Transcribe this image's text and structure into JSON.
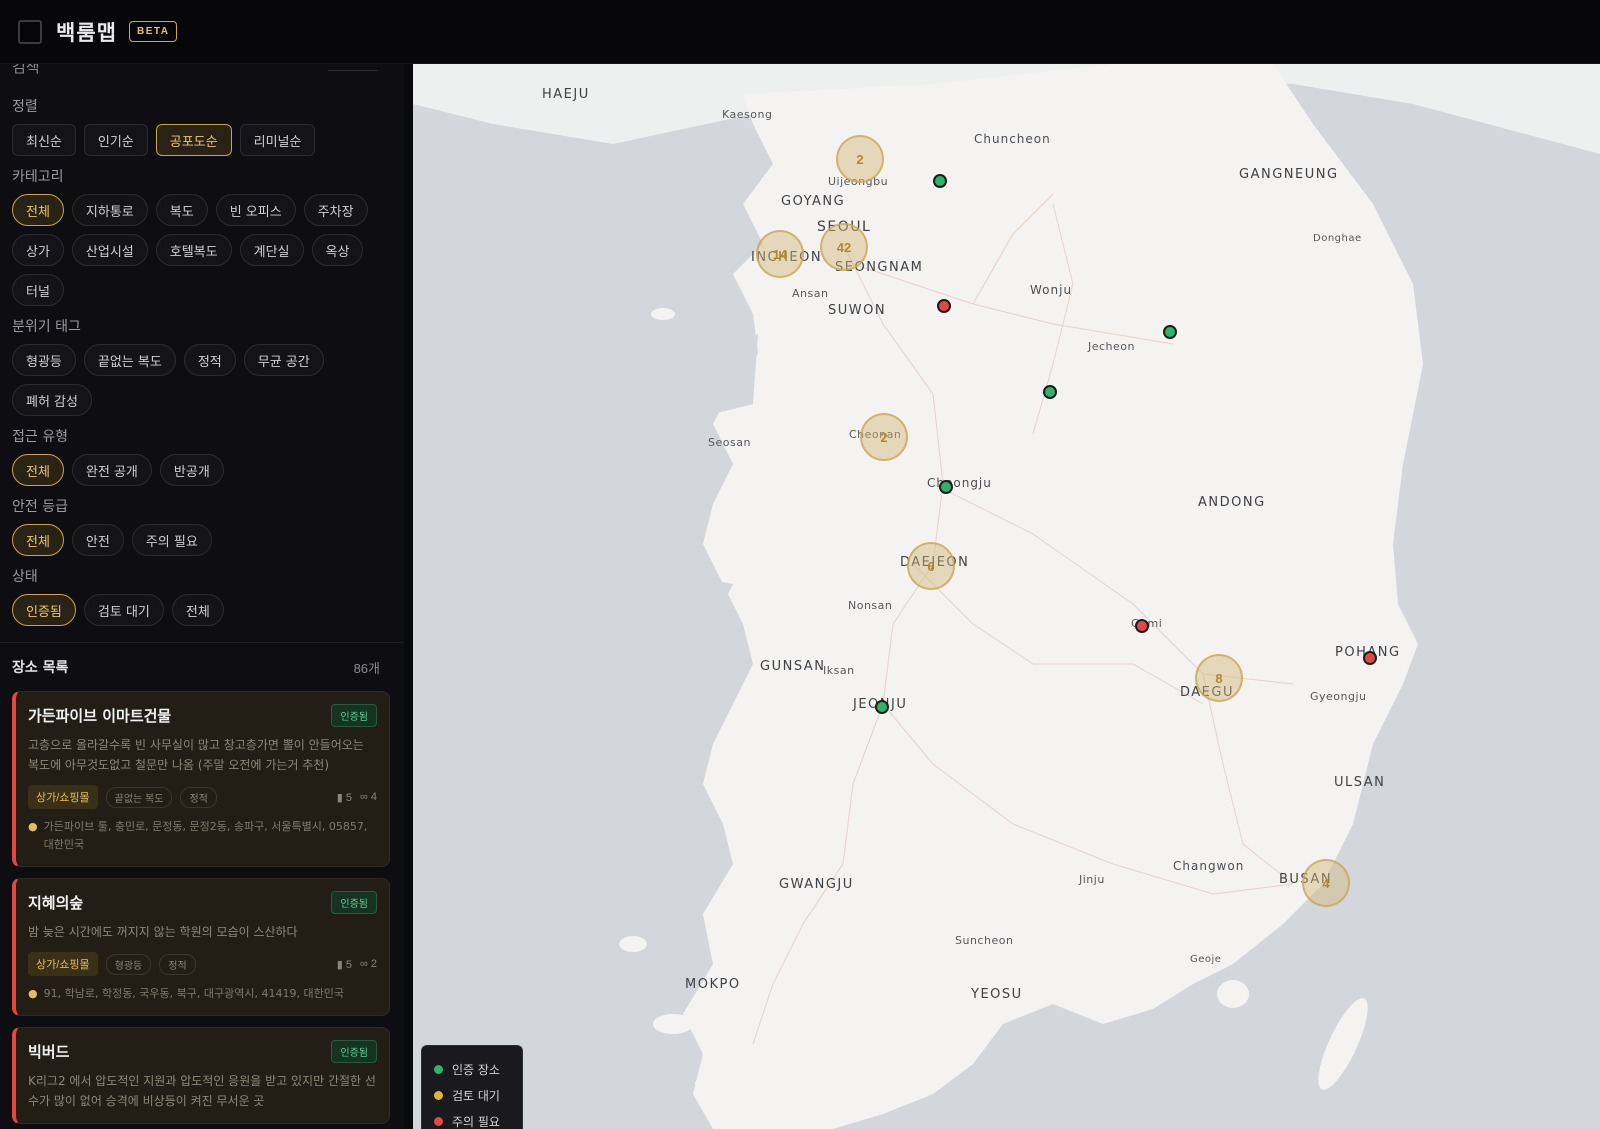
{
  "header": {
    "title": "백룸맵",
    "badge": "BETA"
  },
  "sidebar": {
    "cut_text": "검색",
    "sort": {
      "label": "정렬",
      "options": [
        "최신순",
        "인기순",
        "공포도순",
        "리미널순"
      ],
      "active": 2
    },
    "category": {
      "label": "카테고리",
      "options": [
        "전체",
        "지하통로",
        "복도",
        "빈 오피스",
        "주차장",
        "상가",
        "산업시설",
        "호텔복도",
        "계단실",
        "옥상",
        "터널"
      ],
      "active": 0
    },
    "mood": {
      "label": "분위기 태그",
      "options": [
        "형광등",
        "끝없는 복도",
        "정적",
        "무균 공간",
        "폐허 감성"
      ]
    },
    "access": {
      "label": "접근 유형",
      "options": [
        "전체",
        "완전 공개",
        "반공개"
      ],
      "active": 0
    },
    "safety": {
      "label": "안전 등급",
      "options": [
        "전체",
        "안전",
        "주의 필요"
      ],
      "active": 0
    },
    "status": {
      "label": "상태",
      "options": [
        "인증됨",
        "검토 대기",
        "전체"
      ],
      "active": 0
    },
    "list": {
      "title": "장소 목록",
      "count": "86개",
      "items": [
        {
          "name": "가든파이브 이마트건물",
          "badge": "인증됨",
          "desc": "고층으로 올라갈수록 빈 사무실이 많고 창고층가면 뽈이 안들어오는 복도에 아무것도없고 철문만 나옴 (주말 오전에 가는거 추천)",
          "category": "상가/쇼핑몰",
          "tags": [
            "끝없는 복도",
            "정적"
          ],
          "stat1": "5",
          "stat2": "4",
          "address": "가든파이브 툴, 충민로, 문정동, 문정2동, 송파구, 서울특별시, 05857, 대한민국"
        },
        {
          "name": "지혜의숲",
          "badge": "인증됨",
          "desc": "밤 늦은 시간에도 꺼지지 않는 학원의 모습이 스산하다",
          "category": "상가/쇼핑몰",
          "tags": [
            "형광등",
            "정적"
          ],
          "stat1": "5",
          "stat2": "2",
          "address": "91, 학남로, 학정동, 국우동, 북구, 대구광역시, 41419, 대한민국"
        },
        {
          "name": "빅버드",
          "badge": "인증됨",
          "desc": "K리그2 에서 압도적인 지원과 압도적인 응원을 받고 있지만 간절한 선수가 많이 없어 승격에 비상등이 켜진 무서운 곳",
          "category": "",
          "tags": [],
          "stat1": "",
          "stat2": "",
          "address": ""
        }
      ]
    }
  },
  "map": {
    "labels": [
      {
        "text": "HAEJU",
        "cls": "big"
      },
      {
        "text": "Kaesong",
        "cls": "small"
      },
      {
        "text": "Chuncheon",
        "cls": ""
      },
      {
        "text": "GANGNEUNG",
        "cls": "big"
      },
      {
        "text": "Uijeongbu",
        "cls": "small"
      },
      {
        "text": "GOYANG",
        "cls": "big"
      },
      {
        "text": "SEOUL",
        "cls": "big"
      },
      {
        "text": "Donghae",
        "cls": "small"
      },
      {
        "text": "INCHEON",
        "cls": "big"
      },
      {
        "text": "SEONGNAM",
        "cls": "big"
      },
      {
        "text": "Ansan",
        "cls": "small"
      },
      {
        "text": "SUWON",
        "cls": "big"
      },
      {
        "text": "Wonju",
        "cls": ""
      },
      {
        "text": "Jecheon",
        "cls": "small"
      },
      {
        "text": "Seosan",
        "cls": "small"
      },
      {
        "text": "Cheonan",
        "cls": "small"
      },
      {
        "text": "Cheongju",
        "cls": ""
      },
      {
        "text": "ANDONG",
        "cls": "big"
      },
      {
        "text": "DAEJEON",
        "cls": "big"
      },
      {
        "text": "Nonsan",
        "cls": "small"
      },
      {
        "text": "Gumi",
        "cls": "small"
      },
      {
        "text": "POHANG",
        "cls": "big"
      },
      {
        "text": "GUNSAN",
        "cls": "big"
      },
      {
        "text": "Iksan",
        "cls": "small"
      },
      {
        "text": "DAEGU",
        "cls": "big"
      },
      {
        "text": "Gyeongju",
        "cls": "small"
      },
      {
        "text": "JEONJU",
        "cls": "big"
      },
      {
        "text": "ULSAN",
        "cls": "big"
      },
      {
        "text": "Changwon",
        "cls": ""
      },
      {
        "text": "GWANGJU",
        "cls": "big"
      },
      {
        "text": "Jinju",
        "cls": "small"
      },
      {
        "text": "BUSAN",
        "cls": "big"
      },
      {
        "text": "Suncheon",
        "cls": "small"
      },
      {
        "text": "Geoje",
        "cls": "small"
      },
      {
        "text": "MOKPO",
        "cls": "big"
      },
      {
        "text": "YEOSU",
        "cls": "big"
      }
    ],
    "clusters": [
      "2",
      "14",
      "42",
      "2",
      "6",
      "8",
      "4"
    ],
    "legend": [
      {
        "label": "인증 장소",
        "color": "#2fb36a"
      },
      {
        "label": "검토 대기",
        "color": "#e0b43a"
      },
      {
        "label": "주의 필요",
        "color": "#e04a44"
      }
    ]
  }
}
